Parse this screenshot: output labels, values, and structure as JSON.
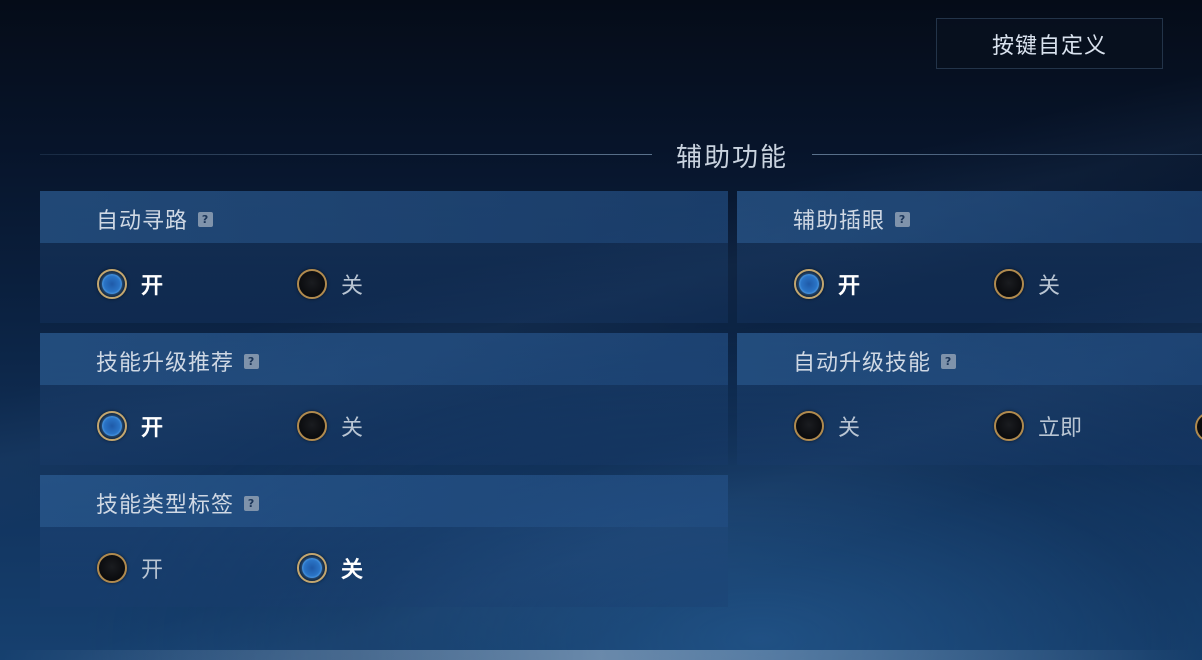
{
  "header": {
    "keybind_button_label": "按键自定义"
  },
  "section": {
    "title": "辅助功能"
  },
  "settings": {
    "auto_pathfinding": {
      "title": "自动寻路",
      "options": [
        {
          "label": "开",
          "selected": true
        },
        {
          "label": "关",
          "selected": false
        }
      ]
    },
    "assist_ward": {
      "title": "辅助插眼",
      "options": [
        {
          "label": "开",
          "selected": true
        },
        {
          "label": "关",
          "selected": false
        }
      ]
    },
    "skill_upgrade_recommend": {
      "title": "技能升级推荐",
      "options": [
        {
          "label": "开",
          "selected": true
        },
        {
          "label": "关",
          "selected": false
        }
      ]
    },
    "auto_skill_upgrade": {
      "title": "自动升级技能",
      "options": [
        {
          "label": "关",
          "selected": false
        },
        {
          "label": "立即",
          "selected": false
        }
      ]
    },
    "skill_type_tag": {
      "title": "技能类型标签",
      "options": [
        {
          "label": "开",
          "selected": false
        },
        {
          "label": "关",
          "selected": true
        }
      ]
    }
  },
  "icons": {
    "help": "help-icon",
    "accent_gold": "#c9a768",
    "accent_blue": "#2a74c6"
  }
}
